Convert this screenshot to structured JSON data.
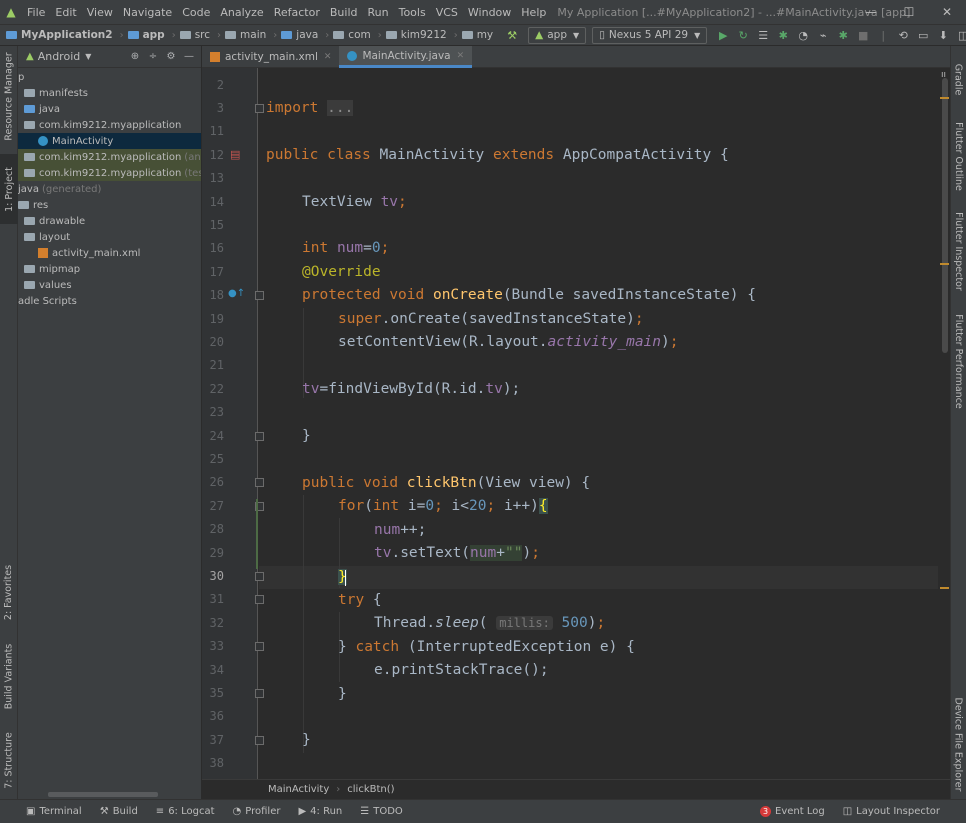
{
  "menu": {
    "items": [
      "File",
      "Edit",
      "View",
      "Navigate",
      "Code",
      "Analyze",
      "Refactor",
      "Build",
      "Run",
      "Tools",
      "VCS",
      "Window",
      "Help"
    ],
    "window_title": "My Application [...#MyApplication2] - ...#MainActivity.java [app]"
  },
  "window_controls": {
    "minimize": "—",
    "maximize": "☐",
    "close": "✕"
  },
  "navbar": {
    "crumbs": [
      "MyApplication2",
      "app",
      "src",
      "main",
      "java",
      "com",
      "kim9212",
      "my"
    ],
    "run_config": "app",
    "device": "Nexus 5 API 29"
  },
  "left_strip": {
    "tabs": [
      "Resource Manager",
      "1: Project",
      "2: Favorites",
      "Build Variants",
      "7: Structure"
    ]
  },
  "right_strip": {
    "tabs": [
      "Gradle",
      "Flutter Outline",
      "Flutter Inspector",
      "Flutter Performance",
      "Device File Explorer"
    ]
  },
  "project": {
    "view_selector": "Android",
    "tree": [
      {
        "label": "p",
        "suffix": ""
      },
      {
        "label": "manifests",
        "suffix": ""
      },
      {
        "label": "java",
        "suffix": ""
      },
      {
        "label": "com.kim9212.myapplication",
        "suffix": ""
      },
      {
        "label": "MainActivity",
        "suffix": ""
      },
      {
        "label": "com.kim9212.myapplication",
        "suffix": "(androidTest)"
      },
      {
        "label": "com.kim9212.myapplication",
        "suffix": "(test)"
      },
      {
        "label": "java",
        "suffix": "(generated)"
      },
      {
        "label": "res",
        "suffix": ""
      },
      {
        "label": "drawable",
        "suffix": ""
      },
      {
        "label": "layout",
        "suffix": ""
      },
      {
        "label": "activity_main.xml",
        "suffix": ""
      },
      {
        "label": "mipmap",
        "suffix": ""
      },
      {
        "label": "values",
        "suffix": ""
      },
      {
        "label": "adle Scripts",
        "suffix": ""
      }
    ]
  },
  "editor_tabs": [
    {
      "label": "activity_main.xml",
      "active": false
    },
    {
      "label": "MainActivity.java",
      "active": true
    }
  ],
  "editor": {
    "line_numbers": [
      "2",
      "3",
      "11",
      "12",
      "13",
      "14",
      "15",
      "16",
      "17",
      "18",
      "19",
      "20",
      "21",
      "22",
      "23",
      "24",
      "25",
      "26",
      "27",
      "28",
      "29",
      "30",
      "31",
      "32",
      "33",
      "34",
      "35",
      "36",
      "37",
      "38"
    ],
    "current_line": "30",
    "code": {
      "l3_import": "import",
      "l3_dots": "...",
      "l12_kw1": "public",
      "l12_kw2": "class",
      "l12_name": "MainActivity",
      "l12_kw3": "extends",
      "l12_parent": "AppCompatActivity {",
      "l14_type": "TextView",
      "l14_field": "tv",
      "l16_kw": "int",
      "l16_field": "num",
      "l16_num": "0",
      "l17_ann": "@Override",
      "l18_kw1": "protected",
      "l18_kw2": "void",
      "l18_fn": "onCreate",
      "l18_rest": "(Bundle savedInstanceState) {",
      "l19_kw": "super",
      "l19_rest": ".onCreate(savedInstanceState)",
      "l20_a": "setContentView(R.layout.",
      "l20_field": "activity_main",
      "l20_b": ")",
      "l22_field": "tv",
      "l22_a": "=findViewById(R.id.",
      "l22_field2": "tv",
      "l22_b": ");",
      "l24": "}",
      "l26_kw1": "public",
      "l26_kw2": "void",
      "l26_fn": "clickBtn",
      "l26_rest": "(View view) {",
      "l27_kw": "for",
      "l27_kw2": "int",
      "l27_a": " i=",
      "l27_n1": "0",
      "l27_b": " i<",
      "l27_n2": "20",
      "l27_c": " i++)",
      "l27_brace": "{",
      "l28_field": "num",
      "l28_rest": "++;",
      "l29_field": "tv",
      "l29_a": ".setText(",
      "l29_field2": "num",
      "l29_plus": "+",
      "l29_str": "\"\"",
      "l29_b": ")",
      "l30_brace": "}",
      "l31_kw": "try",
      "l31_rest": " {",
      "l32_a": "Thread.",
      "l32_fn": "sleep",
      "l32_hint": "millis:",
      "l32_num": "500",
      "l32_b": ")",
      "l33_a": "} ",
      "l33_kw": "catch",
      "l33_rest": " (InterruptedException e) {",
      "l34": "e.printStackTrace();",
      "l35": "}",
      "l37": "}"
    }
  },
  "editor_breadcrumb": [
    "MainActivity",
    "clickBtn()"
  ],
  "bottom": {
    "tabs": [
      "Terminal",
      "Build",
      "6: Logcat",
      "Profiler",
      "4: Run",
      "TODO"
    ],
    "event_log_count": "3",
    "event_log": "Event Log",
    "layout_inspector": "Layout Inspector"
  },
  "colors": {
    "keyword": "#cc7832",
    "function": "#ffc66d",
    "number": "#6897bb",
    "field": "#9876aa",
    "annotation": "#bbb529",
    "string": "#6a8759",
    "accent": "#4a88c7"
  }
}
